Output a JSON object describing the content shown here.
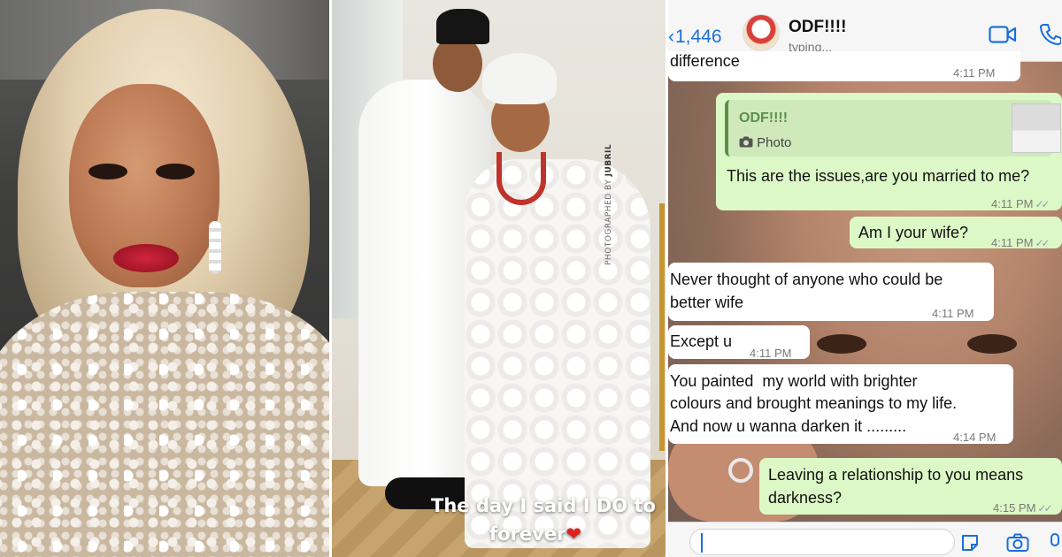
{
  "left_photo": {},
  "story": {
    "line1": "The day I said I DO to",
    "line2": "forever",
    "heart": "❤",
    "credit_prefix": "PHOTOGRAPHED BY",
    "credit_name": "JUBRIL"
  },
  "chat": {
    "header": {
      "back_count": "1,446",
      "contact_name": "ODF!!!!",
      "status": "typing..."
    },
    "messages": [
      {
        "id": "m0",
        "direction": "in",
        "text": "difference",
        "time": "4:11 PM"
      },
      {
        "id": "m1",
        "direction": "out",
        "quote_name": "ODF!!!!",
        "quote_label": "Photo",
        "text": "This are the issues,are you married to me?",
        "time": "4:11 PM"
      },
      {
        "id": "m2",
        "direction": "out",
        "text": "Am I your wife?",
        "time": "4:11 PM"
      },
      {
        "id": "m3",
        "direction": "in",
        "text_line1": "Never thought of anyone who could be",
        "text_line2": "better wife",
        "time": "4:11 PM"
      },
      {
        "id": "m4",
        "direction": "in",
        "text": "Except u",
        "time": "4:11 PM"
      },
      {
        "id": "m5",
        "direction": "in",
        "text_line1": "You painted  my world with brighter",
        "text_line2": "colours and brought meanings to my life.",
        "text_line3": "And now u wanna darken it .........",
        "time": "4:14 PM"
      },
      {
        "id": "m6",
        "direction": "out",
        "text_line1": "Leaving a relationship to you means",
        "text_line2": "darkness?",
        "time": "4:15 PM"
      }
    ],
    "icons": [
      "chevron-left-icon",
      "video-call-icon",
      "phone-icon",
      "sticker-icon",
      "camera-icon",
      "microphone-icon",
      "double-check-icon",
      "photo-icon"
    ],
    "colors": {
      "outgoing_bubble": "#dcf8c6",
      "incoming_bubble": "#ffffff",
      "accent": "#1b6fd9",
      "ticks": "#8fa0a8"
    }
  }
}
